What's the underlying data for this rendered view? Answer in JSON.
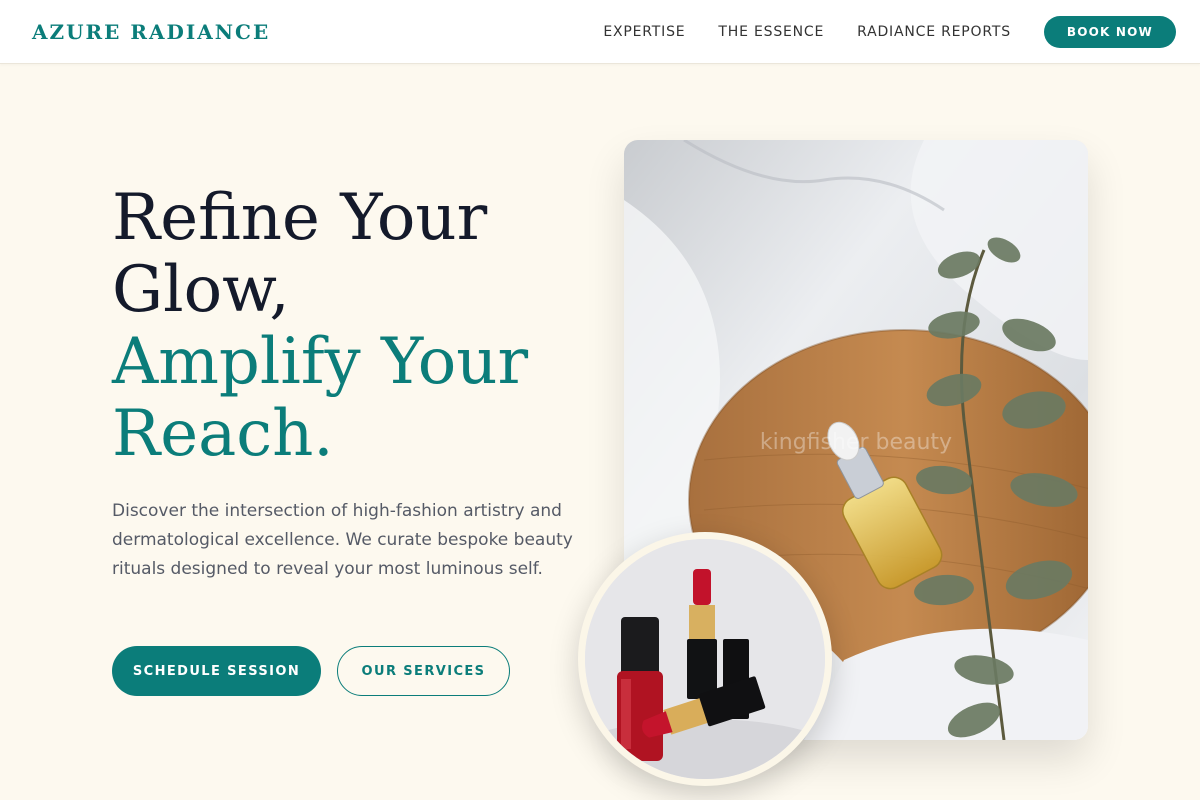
{
  "brand": {
    "name": "AZURE RADIANCE"
  },
  "nav": {
    "links": [
      "EXPERTISE",
      "THE ESSENCE",
      "RADIANCE REPORTS"
    ],
    "cta": "BOOK NOW"
  },
  "hero": {
    "title_line1": "Refine Your",
    "title_line2": "Glow,",
    "title_line3": "Amplify Your",
    "title_line4": "Reach.",
    "description": "Discover the intersection of high-fashion artistry and dermatological excellence. We curate bespoke beauty rituals designed to reveal your most luminous self.",
    "primary_cta": "SCHEDULE SESSION",
    "secondary_cta": "OUR SERVICES"
  },
  "images": {
    "main_watermark": "kingfisher beauty",
    "main_icon": "serum-bottle-on-wood-photo",
    "circle_icon": "lipstick-nail-polish-photo"
  },
  "colors": {
    "accent": "#0b7d7a",
    "background": "#fdf9ef",
    "dark_text": "#141a2b"
  }
}
